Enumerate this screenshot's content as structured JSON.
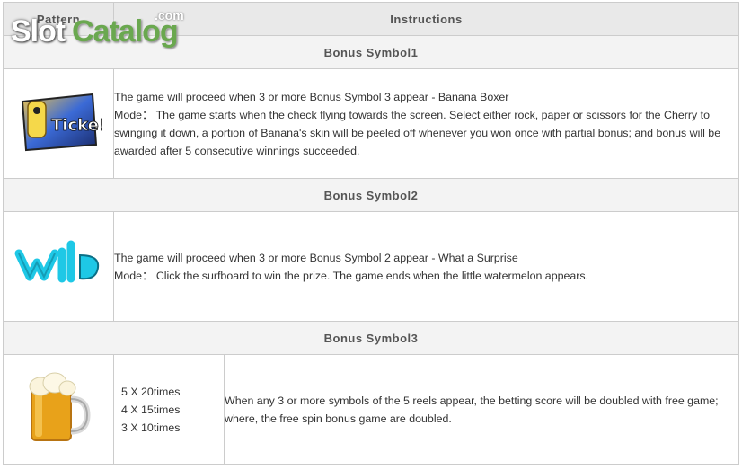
{
  "header": {
    "pattern_label": "Pattern",
    "instructions_label": "Instructions"
  },
  "watermark": {
    "slot": "Slot",
    "catalog": "Catalog",
    "com": ".com"
  },
  "sections": [
    {
      "title": "Bonus Symbol1",
      "icon": "ticket-icon",
      "lines": [
        "The game will proceed when 3 or more Bonus Symbol 3 appear - Banana Boxer",
        "Mode： The game starts when the check flying towards the screen. Select either rock, paper or scissors for the Cherry to swinging it down, a portion of Banana's skin will be peeled off whenever you won once with partial bonus; and bonus will be awarded after 5 consecutive winnings succeeded."
      ]
    },
    {
      "title": "Bonus Symbol2",
      "icon": "wild-icon",
      "lines": [
        "The game will proceed when 3 or more Bonus Symbol 2 appear - What a Surprise",
        "Mode： Click the surfboard to win the prize. The game ends when the little watermelon appears."
      ]
    },
    {
      "title": "Bonus Symbol3",
      "icon": "beer-mug-icon",
      "payouts": [
        "5 X 20times",
        "4 X 15times",
        "3 X 10times"
      ],
      "lines": [
        "When any 3 or more symbols of the 5 reels appear, the betting score will be doubled with free game;",
        "where, the free spin bonus game are doubled."
      ]
    }
  ]
}
